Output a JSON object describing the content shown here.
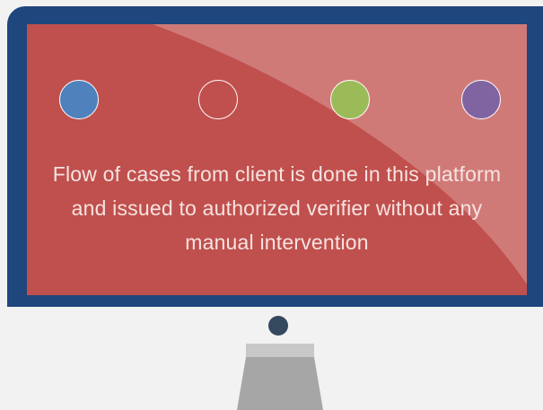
{
  "screen": {
    "caption": "Flow of cases from client is done in this platform and issued to authorized verifier without any manual intervention",
    "dots": [
      {
        "name": "blue-dot",
        "color": "#4f81bd"
      },
      {
        "name": "outline-dot",
        "color": "transparent"
      },
      {
        "name": "green-dot",
        "color": "#9bbb59"
      },
      {
        "name": "purple-dot",
        "color": "#8064a2"
      }
    ]
  },
  "colors": {
    "frame": "#1f467d",
    "screen": "#c0504d",
    "glare": "#d07a77",
    "camera": "#34495e",
    "stand": "#a6a6a6"
  }
}
